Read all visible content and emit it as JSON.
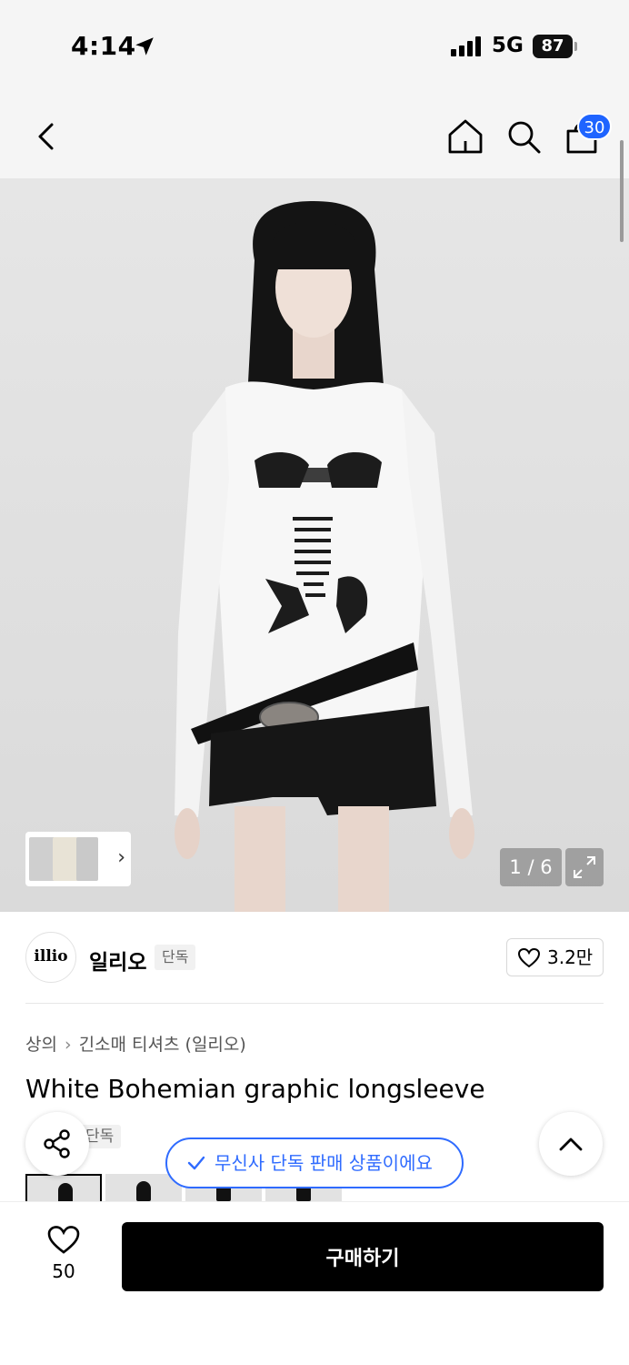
{
  "status_bar": {
    "time": "4:14",
    "network": "5G",
    "battery": "87"
  },
  "nav": {
    "cart_count": "30",
    "icons": [
      "back-icon",
      "home-icon",
      "search-icon",
      "cart-icon"
    ]
  },
  "gallery": {
    "counter": "1 / 6",
    "thumb_chevron": "›"
  },
  "brand": {
    "logo_text": "illio",
    "name": "일리오",
    "badge": "단독",
    "likes": "3.2만"
  },
  "breadcrumb": {
    "items": [
      "상의",
      "긴소매 티셔츠 (일리오)"
    ],
    "separator": "›"
  },
  "product": {
    "title": "White Bohemian graphic longsleeve",
    "badge": "단독",
    "exclusive_notice": "무신사 단독 판매 상품이에요"
  },
  "bottom": {
    "wish_count": "50",
    "buy_label": "구매하기"
  },
  "colors": {
    "accent_blue": "#2f6bff",
    "badge_blue": "#1f64ff",
    "buy_button": "#000000"
  }
}
